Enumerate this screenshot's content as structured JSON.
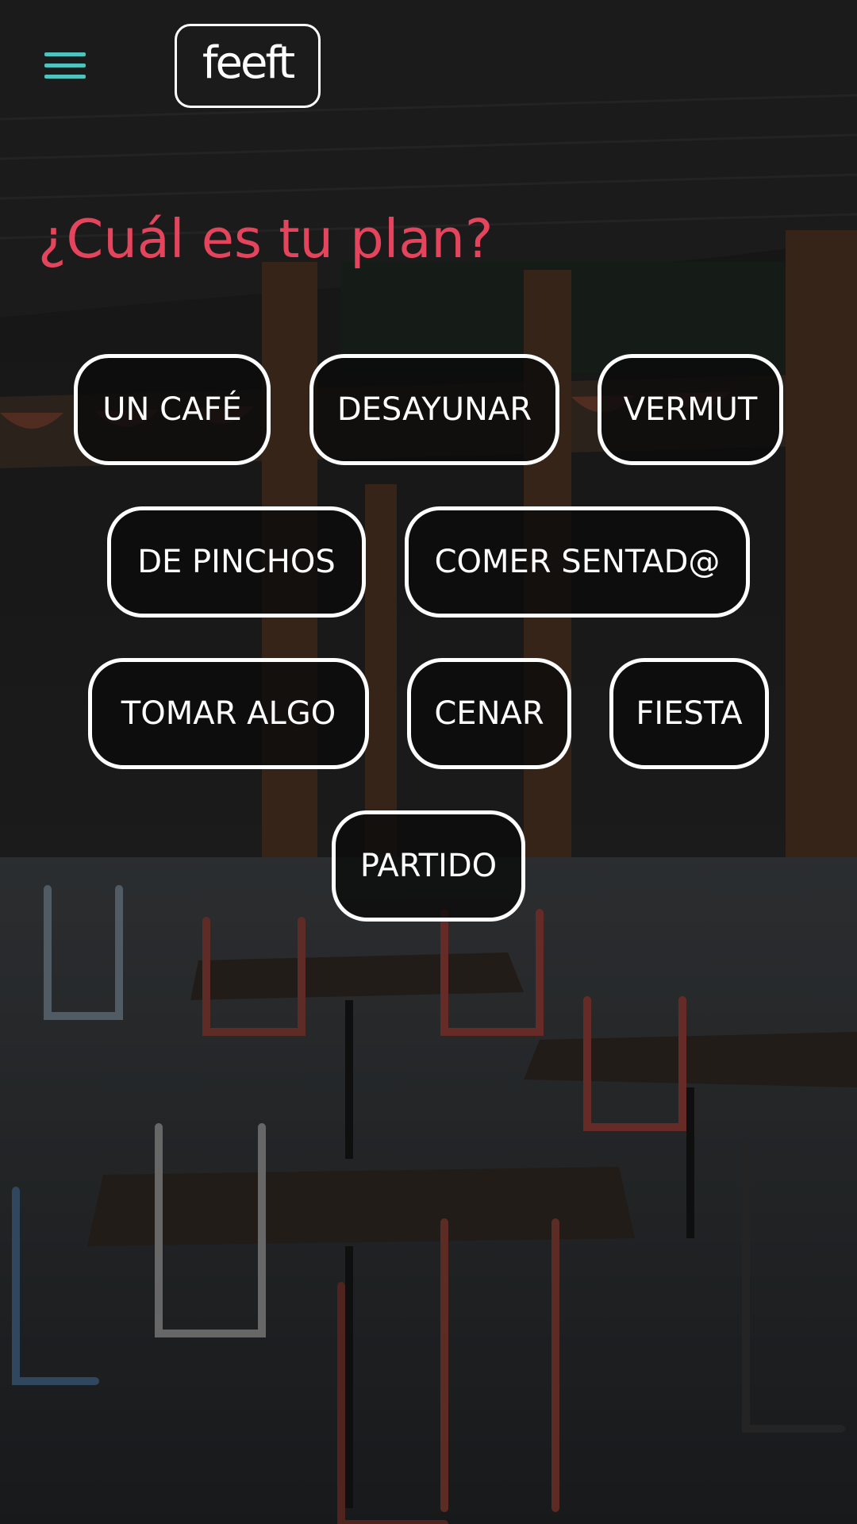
{
  "header": {
    "menu_icon": "menu-icon",
    "logo_text": "feeft"
  },
  "main": {
    "title": "¿Cuál es tu plan?",
    "options": [
      "UN CAFÉ",
      "DESAYUNAR",
      "VERMUT",
      "DE PINCHOS",
      "COMER SENTAD@",
      "TOMAR ALGO",
      "CENAR",
      "FIESTA",
      "PARTIDO"
    ]
  },
  "colors": {
    "accent_title": "#e5445d",
    "menu_icon": "#4fc3bd",
    "chip_border": "#ffffff",
    "chip_background": "#0a0a0a"
  }
}
